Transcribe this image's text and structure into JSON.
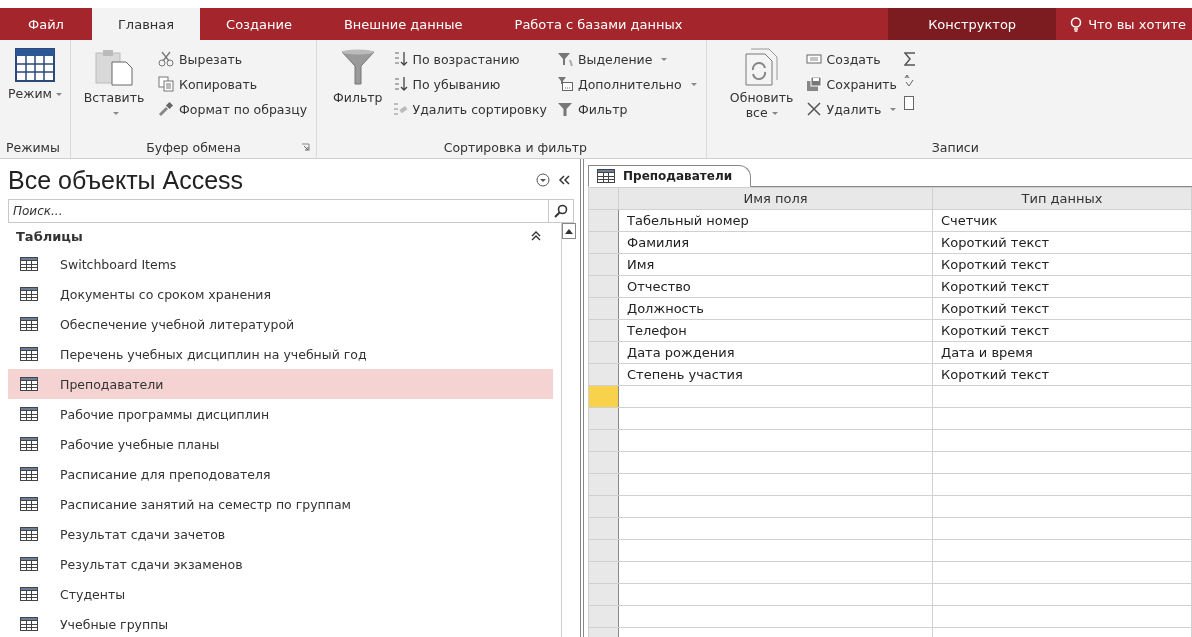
{
  "ribbon_tabs": [
    {
      "label": "Файл",
      "selected": false,
      "kind": "file"
    },
    {
      "label": "Главная",
      "selected": true,
      "kind": "normal"
    },
    {
      "label": "Создание",
      "selected": false,
      "kind": "normal"
    },
    {
      "label": "Внешние данные",
      "selected": false,
      "kind": "normal"
    },
    {
      "label": "Работа с базами данных",
      "selected": false,
      "kind": "normal"
    },
    {
      "label": "Конструктор",
      "selected": false,
      "kind": "contextual"
    }
  ],
  "tell_me": "Что вы хотите",
  "ribbon_groups": [
    {
      "label": "Режимы",
      "columns": [
        [
          {
            "kind": "large",
            "label": "Режим",
            "dropdown": true
          }
        ]
      ]
    },
    {
      "label": "Буфер обмена",
      "launcher": true,
      "columns": [
        [
          {
            "kind": "large",
            "label": "Вставить",
            "dropdown": true
          }
        ],
        [
          {
            "kind": "small",
            "label": "Вырезать",
            "dropdown": false
          },
          {
            "kind": "small",
            "label": "Копировать",
            "dropdown": false
          },
          {
            "kind": "small",
            "label": "Формат по образцу",
            "dropdown": false
          }
        ]
      ]
    },
    {
      "label": "Сортировка и фильтр",
      "launcher": false,
      "columns": [
        [
          {
            "kind": "large",
            "label": "Фильтр",
            "dropdown": false
          }
        ],
        [
          {
            "kind": "small",
            "label": "По возрастанию",
            "dropdown": false
          },
          {
            "kind": "small",
            "label": "По убыванию",
            "dropdown": false
          },
          {
            "kind": "small",
            "label": "Удалить сортировку",
            "dropdown": false
          }
        ],
        [
          {
            "kind": "small",
            "label": "Выделение",
            "dropdown": true
          },
          {
            "kind": "small",
            "label": "Дополнительно",
            "dropdown": true
          },
          {
            "kind": "small",
            "label": "Фильтр",
            "dropdown": false
          }
        ]
      ]
    },
    {
      "label": "Записи",
      "launcher": false,
      "columns": [
        [
          {
            "kind": "large",
            "label": "Обновить все",
            "dropdown": true
          }
        ],
        [
          {
            "kind": "small",
            "label": "Создать",
            "dropdown": false
          },
          {
            "kind": "small",
            "label": "Сохранить",
            "dropdown": false
          },
          {
            "kind": "small",
            "label": "Удалить",
            "dropdown": true
          }
        ],
        [
          {
            "kind": "icons"
          }
        ]
      ]
    }
  ],
  "nav_pane": {
    "title": "Все объекты Access",
    "search": {
      "placeholder": "Поиск..."
    },
    "section": {
      "label": "Таблицы",
      "expanded": true
    },
    "items": [
      {
        "label": "Switchboard Items",
        "selected": false
      },
      {
        "label": "Документы со сроком хранения",
        "selected": false
      },
      {
        "label": "Обеспечение учебной литературой",
        "selected": false
      },
      {
        "label": "Перечень учебных дисциплин на учебный год",
        "selected": false
      },
      {
        "label": "Преподаватели",
        "selected": true
      },
      {
        "label": "Рабочие программы дисциплин",
        "selected": false
      },
      {
        "label": "Рабочие учебные планы",
        "selected": false
      },
      {
        "label": "Расписание для преподователя",
        "selected": false
      },
      {
        "label": "Расписание занятий на семестр по группам",
        "selected": false
      },
      {
        "label": "Результат сдачи зачетов",
        "selected": false
      },
      {
        "label": "Результат сдачи экзаменов",
        "selected": false
      },
      {
        "label": "Студенты",
        "selected": false
      },
      {
        "label": "Учебные группы",
        "selected": false
      }
    ]
  },
  "document": {
    "tab": "Преподаватели",
    "columns": [
      "Имя поля",
      "Тип данных"
    ],
    "rows": [
      {
        "field_name": "Табельный номер",
        "data_type": "Счетчик",
        "selected": false
      },
      {
        "field_name": "Фамилия",
        "data_type": "Короткий текст",
        "selected": false
      },
      {
        "field_name": "Имя",
        "data_type": "Короткий текст",
        "selected": false
      },
      {
        "field_name": "Отчество",
        "data_type": "Короткий текст",
        "selected": false
      },
      {
        "field_name": "Должность",
        "data_type": "Короткий текст",
        "selected": false
      },
      {
        "field_name": "Телефон",
        "data_type": "Короткий текст",
        "selected": false
      },
      {
        "field_name": "Дата рождения",
        "data_type": "Дата и время",
        "selected": false
      },
      {
        "field_name": "Степень участия",
        "data_type": "Короткий текст",
        "selected": false
      }
    ],
    "new_row": {
      "selected": true
    }
  }
}
